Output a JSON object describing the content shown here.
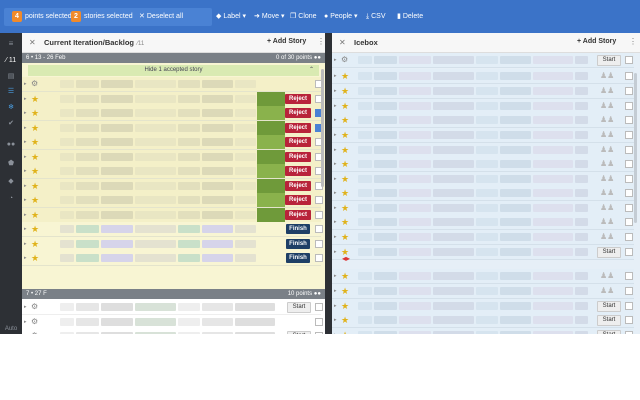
{
  "toolbar": {
    "points_count": "4",
    "points_label": "points selected",
    "stories_count": "2",
    "stories_label": "stories selected",
    "deselect_label": "Deselect all",
    "label_btn": "Label",
    "move_btn": "Move",
    "clone_btn": "Clone",
    "people_btn": "People",
    "csv_btn": "CSV",
    "delete_btn": "Delete"
  },
  "nav": {
    "count": "11",
    "auto": "Auto"
  },
  "backlog": {
    "title": "Current Iteration/Backlog",
    "count": "11",
    "add_story": "Add Story",
    "iteration1": {
      "label": "6 • 13 - 26 Feb",
      "points": "0 of 30 points"
    },
    "hide_accepted": "Hide 1 accepted story",
    "iteration2": {
      "label": "7 • 27 F",
      "points": "10 points"
    },
    "reject_label": "Reject",
    "finish_label": "Finish",
    "start_label": "Start"
  },
  "icebox": {
    "title": "Icebox",
    "add_story": "Add Story",
    "start_label": "Start"
  },
  "colors": {
    "topbar": "#3b73c8",
    "reject": "#b8233a",
    "finish": "#1e3f66",
    "accepted_bg": "#f7f4cf",
    "icebox_bg": "#e3eef7",
    "badge": "#f08a2b"
  }
}
